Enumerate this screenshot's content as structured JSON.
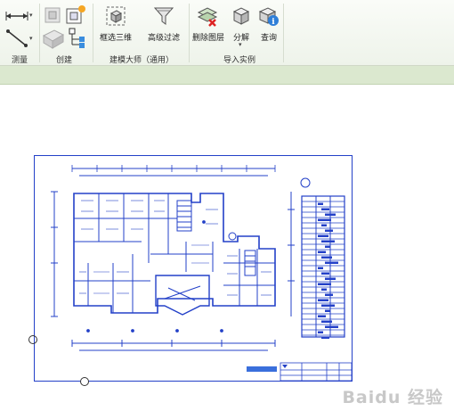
{
  "ribbon": {
    "panels": [
      {
        "label": "测量"
      },
      {
        "label": "创建"
      },
      {
        "label": "建模大师（通用）"
      },
      {
        "label": "导入实例"
      }
    ],
    "tools": {
      "box_3d": "框选三维",
      "advanced_filter": "高级过滤",
      "delete_layer": "删除图层",
      "explode": "分解",
      "query": "查询"
    }
  },
  "canvas": {
    "watermark": "Baidu 经验"
  },
  "colors": {
    "drawing": "#2340c8",
    "ribbon_bg": "#eef3ea",
    "strip": "#dbe8cf"
  }
}
